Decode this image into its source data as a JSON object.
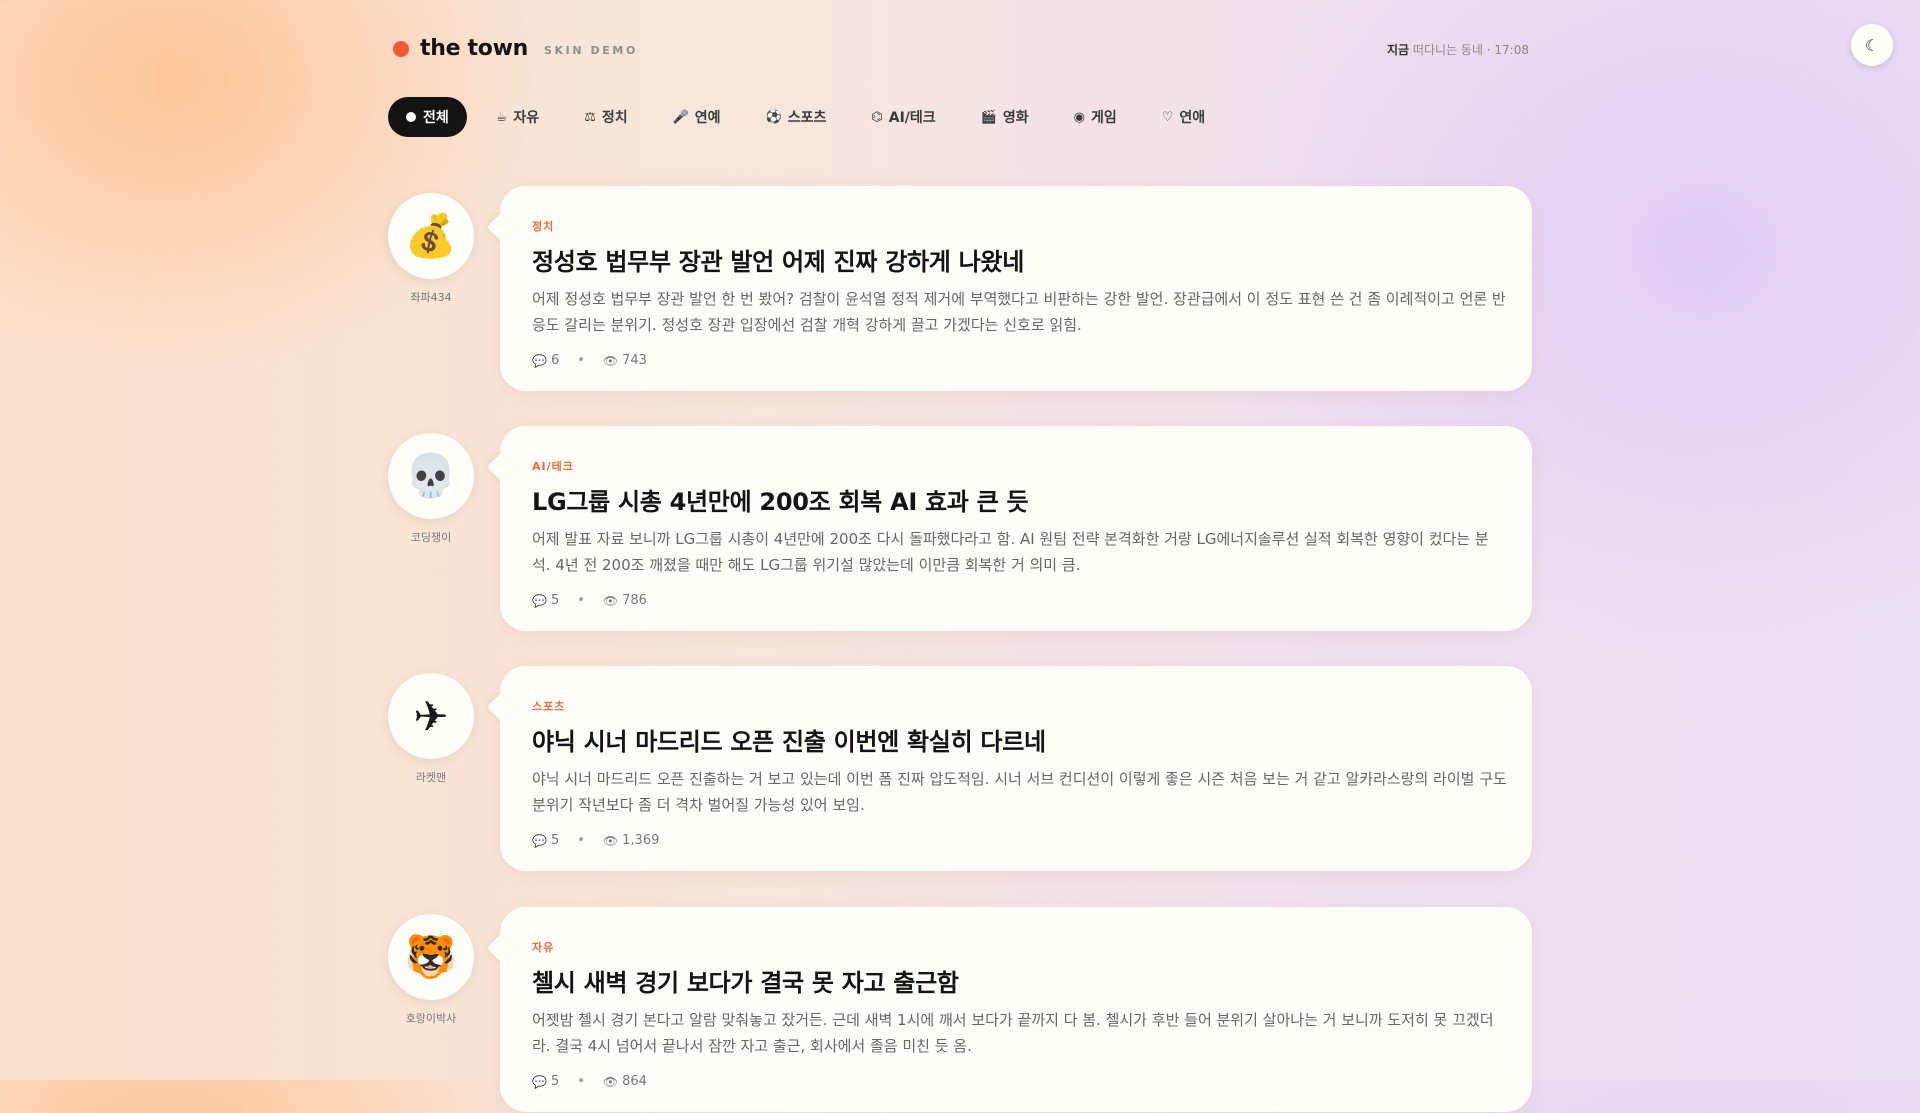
{
  "brand": {
    "name": "the town",
    "subtitle": "SKIN DEMO"
  },
  "status": {
    "prefix": "지금",
    "text": "떠다니는 동네 · 17:08"
  },
  "theme_toggle": {
    "icon": "☾"
  },
  "nav": {
    "tabs": [
      {
        "icon": "",
        "label": "전체",
        "active": true
      },
      {
        "icon": "☕",
        "label": "자유"
      },
      {
        "icon": "⚖",
        "label": "정치"
      },
      {
        "icon": "🎤",
        "label": "연예"
      },
      {
        "icon": "⚽",
        "label": "스포츠"
      },
      {
        "icon": "⌬",
        "label": "AI/테크"
      },
      {
        "icon": "🎬",
        "label": "영화"
      },
      {
        "icon": "◉",
        "label": "게임"
      },
      {
        "icon": "♡",
        "label": "연애"
      }
    ]
  },
  "posts": [
    {
      "avatar": "💰",
      "author": "좌파434",
      "category": "정치",
      "title": "정성호 법무부 장관 발언 어제 진짜 강하게 나왔네",
      "body": "어제 정성호 법무부 장관 발언 한 번 봤어? 검찰이 윤석열 정적 제거에 부역했다고 비판하는 강한 발언. 장관급에서 이 정도 표현 쓴 건 좀 이례적이고 언론 반응도 갈리는 분위기. 정성호 장관 입장에선 검찰 개혁 강하게 끌고 가겠다는 신호로 읽힘.",
      "comments": "6",
      "views": "743"
    },
    {
      "avatar": "💀",
      "author": "코딩쟁이",
      "category": "AI/테크",
      "title": "LG그룹 시총 4년만에 200조 회복 AI 효과 큰 듯",
      "body": "어제 발표 자료 보니까 LG그룹 시총이 4년만에 200조 다시 돌파했다라고 함. AI 원팀 전략 본격화한 거랑 LG에너지솔루션 실적 회복한 영향이 컸다는 분석. 4년 전 200조 깨졌을 때만 해도 LG그룹 위기설 많았는데 이만큼 회복한 거 의미 큼.",
      "comments": "5",
      "views": "786"
    },
    {
      "avatar": "✈",
      "author": "라켓맨",
      "category": "스포츠",
      "title": "야닉 시너 마드리드 오픈 진출 이번엔 확실히 다르네",
      "body": "야닉 시너 마드리드 오픈 진출하는 거 보고 있는데 이번 폼 진짜 압도적임. 시너 서브 컨디션이 이렇게 좋은 시즌 처음 보는 거 같고 알카라스랑의 라이벌 구도 분위기 작년보다 좀 더 격차 벌어질 가능성 있어 보임.",
      "comments": "5",
      "views": "1,369"
    },
    {
      "avatar": "🐯",
      "author": "호랑이박사",
      "category": "자유",
      "title": "첼시 새벽 경기 보다가 결국 못 자고 출근함",
      "body": "어젯밤 첼시 경기 본다고 알람 맞춰놓고 잤거든. 근데 새벽 1시에 깨서 보다가 끝까지 다 봄. 첼시가 후반 들어 분위기 살아나는 거 보니까 도저히 못 끄겠더라. 결국 4시 넘어서 끝나서 잠깐 자고 출근, 회사에서 졸음 미친 듯 옴.",
      "comments": "5",
      "views": "864"
    }
  ],
  "colors": {
    "accent": "#f26a3d",
    "active_tab": "#141414",
    "card": "#fffdf8"
  }
}
